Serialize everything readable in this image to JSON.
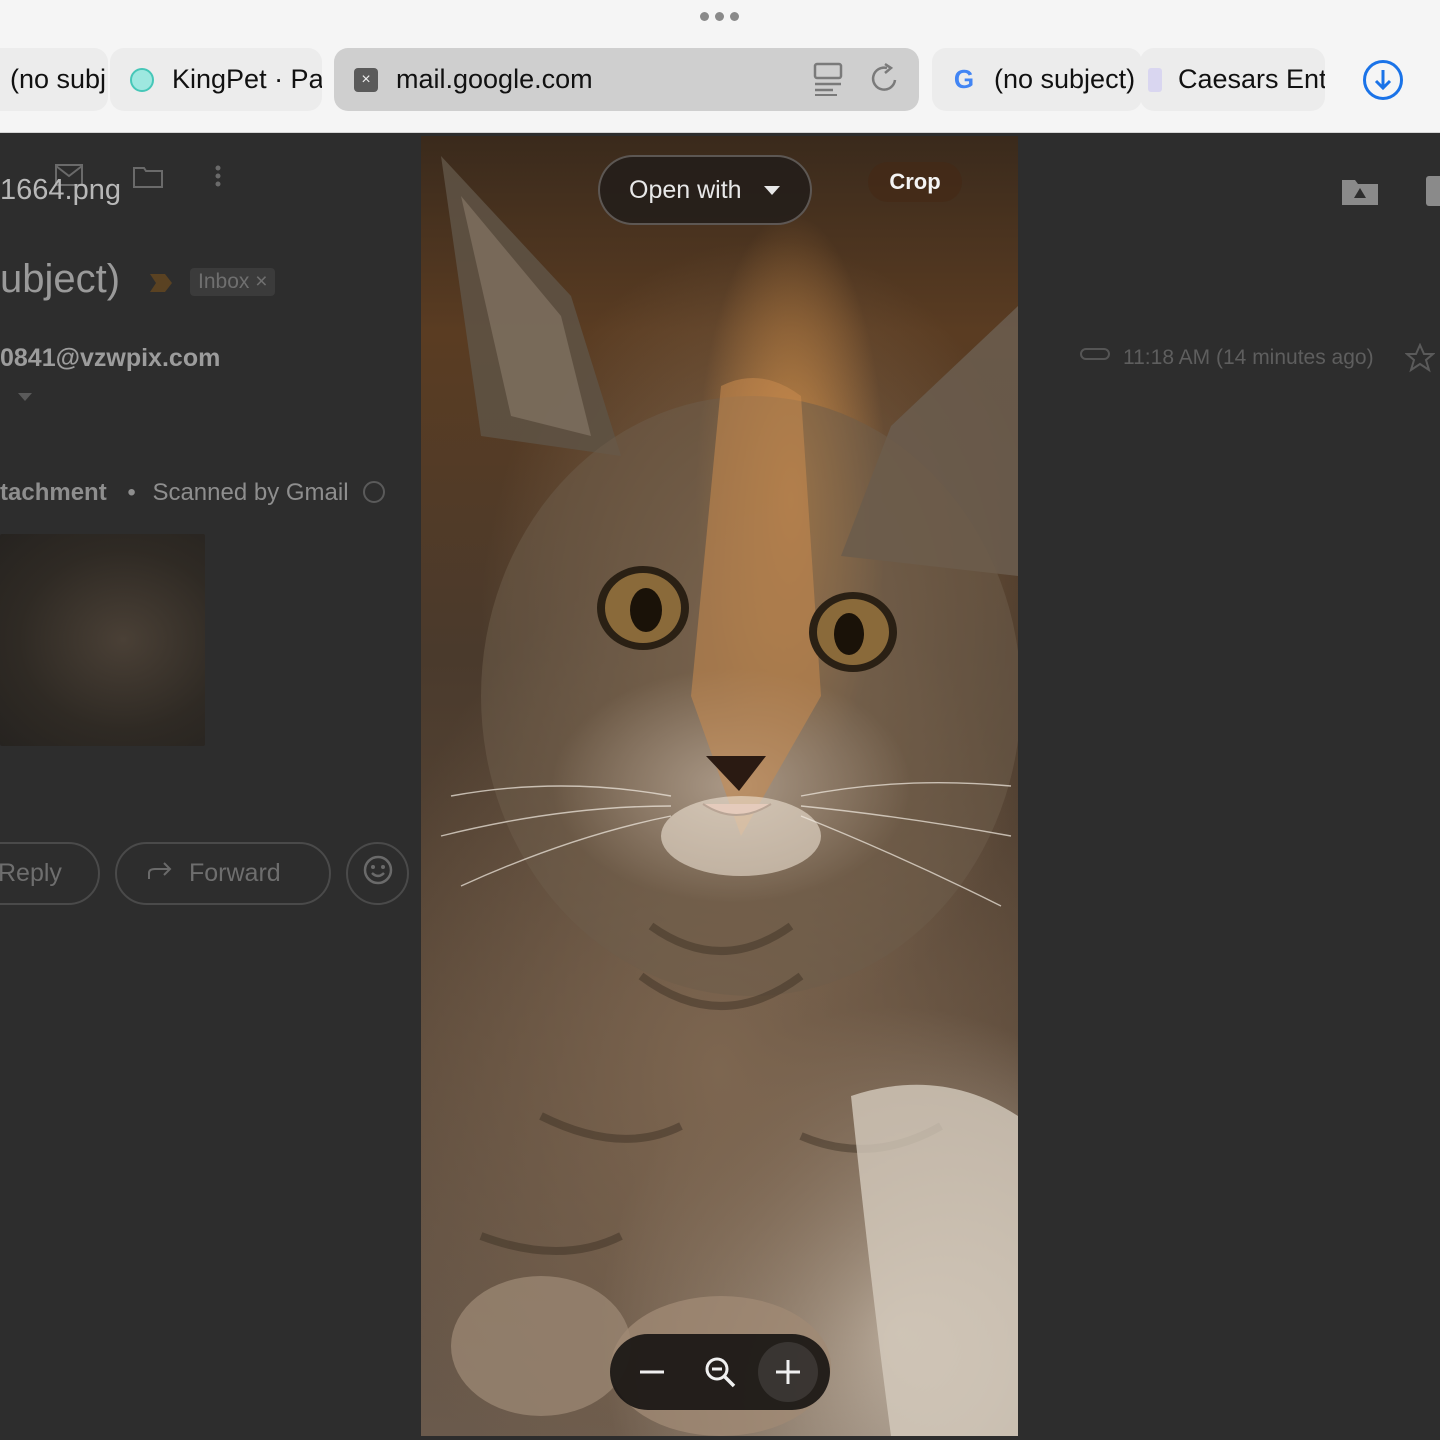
{
  "browser": {
    "tabs": [
      {
        "label": "(no subj",
        "icon": "gmail-icon"
      },
      {
        "label": "KingPet · Pa",
        "icon": "kingpet-icon"
      },
      {
        "label": "mail.google.com",
        "icon": "close-tab-icon",
        "active": true
      },
      {
        "label": "(no subject)",
        "icon": "google-icon"
      },
      {
        "label": "Caesars Ent",
        "icon": "caesars-icon"
      }
    ],
    "accent": "#1a73e8"
  },
  "gmail": {
    "filename": "1664.png",
    "subject": "ubject)",
    "label": "Inbox ×",
    "sender": "0841@vzwpix.com",
    "time": "11:18 AM (14 minutes ago)",
    "attachment_title": "tachment",
    "attachment_sep": "•",
    "scanned_text": "Scanned by Gmail",
    "reply_label": "Reply",
    "forward_label": "Forward"
  },
  "viewer": {
    "open_with_label": "Open with",
    "crop_label": "Crop"
  }
}
